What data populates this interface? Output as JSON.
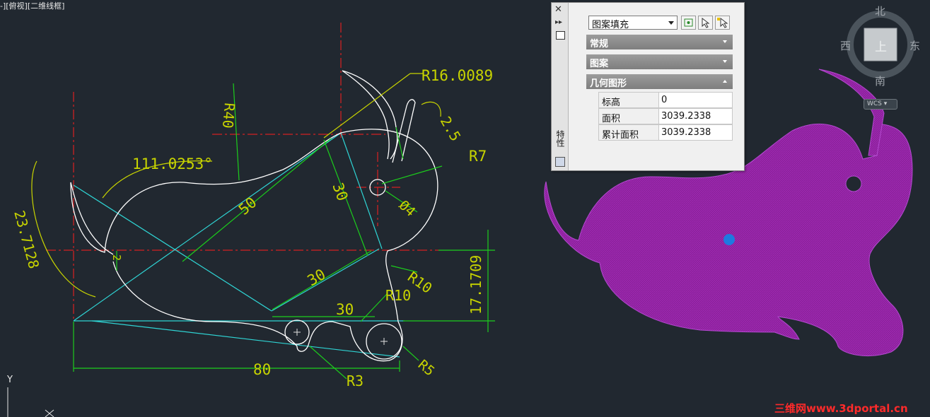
{
  "viewport": {
    "label": "-][俯视][二维线框]"
  },
  "colors": {
    "background": "#212830",
    "dimension": "#c8d400",
    "dimension_line": "#1ccd1c",
    "centerline": "#ff1e1e",
    "construction": "#2fd4d4",
    "geometry": "#ffffff",
    "hatch": "#8a1f9a",
    "grip": "#1e7ae0",
    "annotation": "#e01818"
  },
  "dimensions": {
    "r16": "R16.0089",
    "r40": "R40",
    "d2_5": "2.5",
    "r7": "R7",
    "angle": "111.0253°",
    "d30_vertical": "30",
    "d50": "50",
    "phi4": "Ø4",
    "d23": "23.7128",
    "d2": "2",
    "d30_diag": "30",
    "r10_right": "R10",
    "r10_top": "R10",
    "d30_horizontal": "30",
    "d17": "17.1709",
    "d80": "80",
    "r3": "R3",
    "r5": "R5"
  },
  "ucs": {
    "y_label": "Y",
    "x_label": "X"
  },
  "palette": {
    "title": "特性",
    "selected_type": "图案填充",
    "sections": {
      "general": "常规",
      "pattern": "图案",
      "geometry": "几何图形"
    },
    "properties": [
      {
        "name": "标高",
        "value": "0"
      },
      {
        "name": "面积",
        "value": "3039.2338"
      },
      {
        "name": "累计面积",
        "value": "3039.2338"
      }
    ]
  },
  "viewcube": {
    "north": "北",
    "south": "南",
    "east": "东",
    "west": "西",
    "face": "上",
    "wcs": "WCS"
  },
  "watermark": "三维网www.3dportal.cn"
}
